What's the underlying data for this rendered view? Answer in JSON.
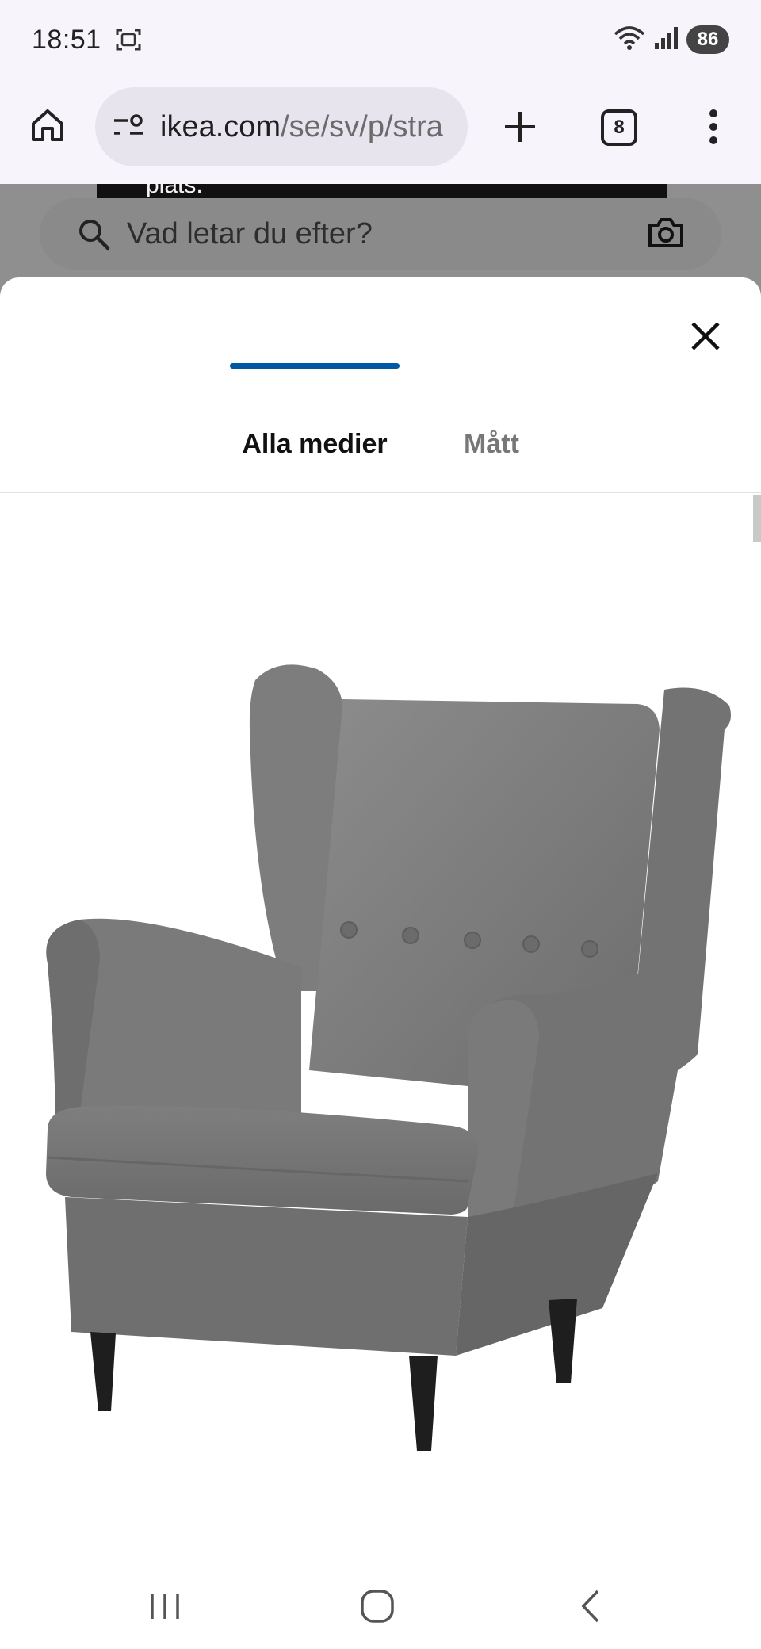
{
  "status_bar": {
    "time": "18:51",
    "battery": "86"
  },
  "browser": {
    "url_host": "ikea.com",
    "url_path": "/se/sv/p/stra",
    "tab_count": "8"
  },
  "background_page": {
    "toast_text": "plats.",
    "search_placeholder": "Vad letar du efter?"
  },
  "media_sheet": {
    "tabs": [
      {
        "label": "Alla medier",
        "active": true
      },
      {
        "label": "Mått",
        "active": false
      }
    ],
    "accent_color": "#0058a3",
    "image_subject": "grey-wingback-armchair"
  },
  "navigation": {
    "buttons": [
      "recent-apps-icon",
      "home-icon",
      "back-icon"
    ]
  }
}
